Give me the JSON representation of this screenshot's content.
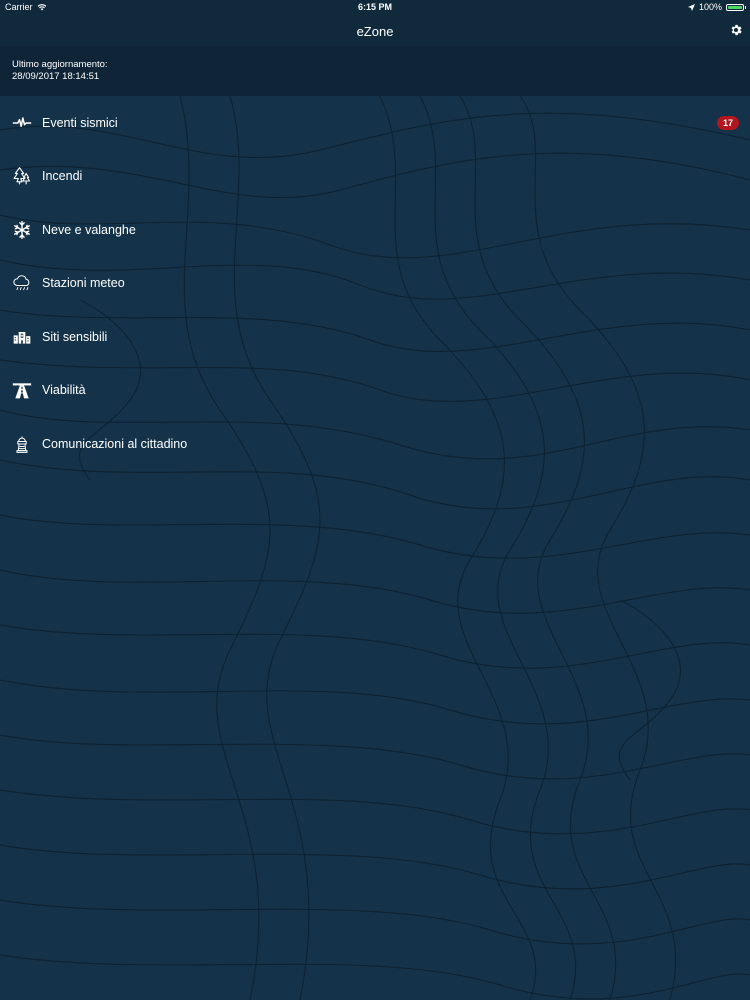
{
  "status_bar": {
    "carrier": "Carrier",
    "time": "6:15 PM",
    "battery": "100%",
    "battery_level": 1.0
  },
  "nav": {
    "title": "eZone"
  },
  "update": {
    "label": "Ultimo aggiornamento:",
    "timestamp": "28/09/2017 18:14:51"
  },
  "menu": {
    "items": [
      {
        "label": "Eventi sismici",
        "icon": "seismic-icon",
        "badge": "17"
      },
      {
        "label": "Incendi",
        "icon": "fire-trees-icon"
      },
      {
        "label": "Neve e valanghe",
        "icon": "snowflake-icon"
      },
      {
        "label": "Stazioni meteo",
        "icon": "rain-cloud-icon"
      },
      {
        "label": "Siti sensibili",
        "icon": "building-icon"
      },
      {
        "label": "Viabilità",
        "icon": "highway-icon"
      },
      {
        "label": "Comunicazioni al cittadino",
        "icon": "megaphone-tower-icon"
      }
    ]
  },
  "colors": {
    "background": "#14334a",
    "bar": "#102a3c",
    "badge": "#b0161c",
    "battery": "#4cd964"
  }
}
